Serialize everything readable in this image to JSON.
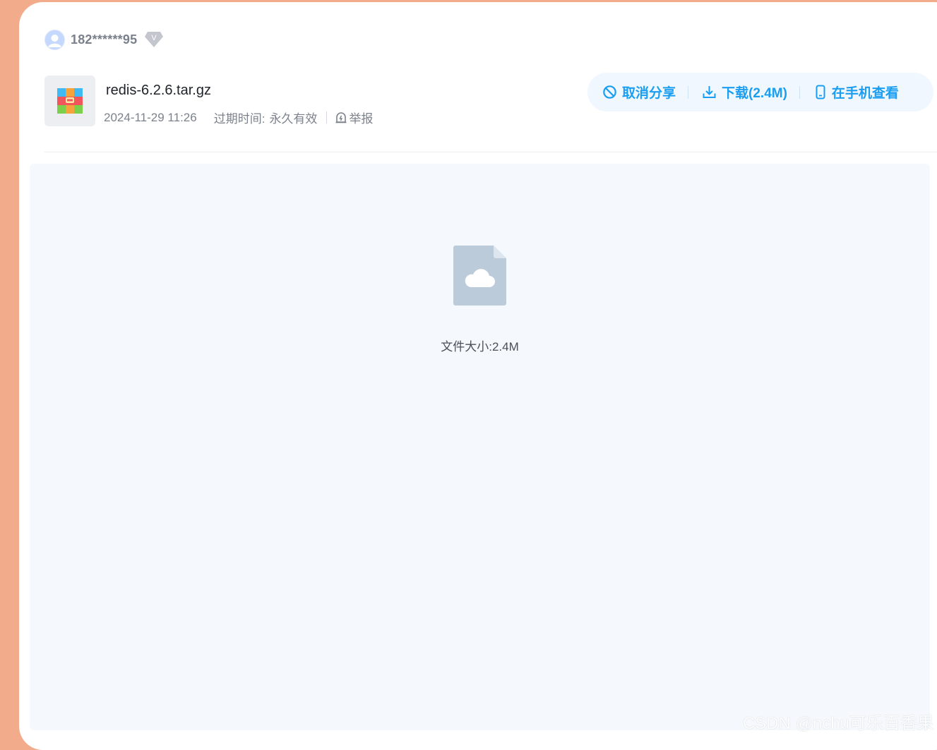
{
  "user": {
    "username": "182******95",
    "vip_badge": "V"
  },
  "file": {
    "name": "redis-6.2.6.tar.gz",
    "date": "2024-11-29 11:26",
    "expire_label": "过期时间:",
    "expire_value": "永久有效",
    "report_label": "举报",
    "icon": "archive-icon"
  },
  "actions": {
    "cancel_share": "取消分享",
    "download": "下载(2.4M)",
    "view_on_phone": "在手机查看"
  },
  "preview": {
    "icon": "cloud-file-icon",
    "size_text": "文件大小:2.4M"
  },
  "watermark": "CSDN @nchu可乐百香果",
  "colors": {
    "accent": "#1a9ef2",
    "page_background": "#f2ac8c",
    "preview_background": "#f5f9fe"
  }
}
